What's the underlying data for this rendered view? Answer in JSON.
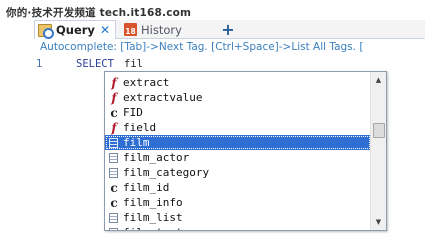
{
  "watermark": "你的·技术开发频道 tech.it168.com",
  "tabs": {
    "query": {
      "label": "Query",
      "close": "✕",
      "icon": "query-icon"
    },
    "history": {
      "label": "History",
      "badge": "18",
      "icon": "calendar-icon"
    },
    "add": "+"
  },
  "editor": {
    "hint": "Autocomplete: [Tab]->Next Tag. [Ctrl+Space]->List All Tags. [",
    "line_number": "1",
    "keyword": "SELECT",
    "typed": "fil"
  },
  "autocomplete": {
    "items": [
      {
        "icon": "f",
        "kind": "function",
        "label": "extract"
      },
      {
        "icon": "f",
        "kind": "function",
        "label": "extractvalue"
      },
      {
        "icon": "c",
        "kind": "column",
        "label": "FID"
      },
      {
        "icon": "f",
        "kind": "function",
        "label": "field"
      },
      {
        "icon": "t",
        "kind": "table",
        "label": "film",
        "selected": true
      },
      {
        "icon": "t",
        "kind": "table",
        "label": "film_actor"
      },
      {
        "icon": "t",
        "kind": "table",
        "label": "film_category"
      },
      {
        "icon": "c",
        "kind": "column",
        "label": "film_id"
      },
      {
        "icon": "c",
        "kind": "column",
        "label": "film_info"
      },
      {
        "icon": "t",
        "kind": "table",
        "label": "film_list"
      },
      {
        "icon": "t",
        "kind": "table",
        "label": "film_text"
      }
    ],
    "scroll_up": "▲",
    "scroll_down": "▼"
  },
  "colors": {
    "selection": "#2f6fd3",
    "hint_text": "#3a7fbf",
    "keyword": "#2b3f9a",
    "function_icon": "#b0182a"
  }
}
